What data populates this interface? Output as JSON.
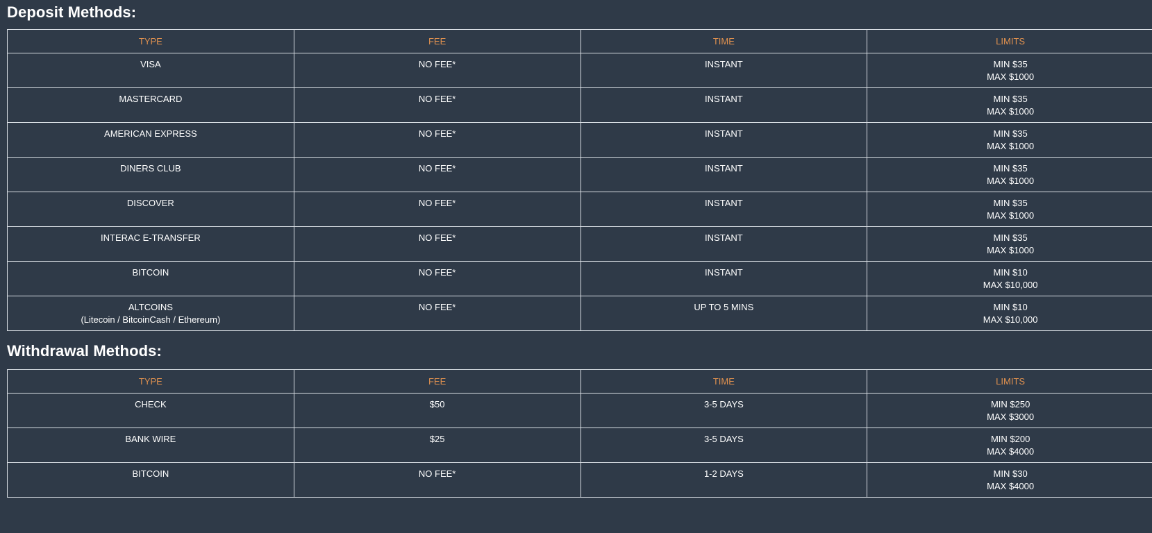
{
  "deposit": {
    "title": "Deposit Methods:",
    "headers": [
      "TYPE",
      "FEE",
      "TIME",
      "LIMITS"
    ],
    "rows": [
      {
        "type": "VISA",
        "type_sub": "",
        "fee": "NO FEE*",
        "time": "INSTANT",
        "min": "MIN $35",
        "max": "MAX $1000"
      },
      {
        "type": "MASTERCARD",
        "type_sub": "",
        "fee": "NO FEE*",
        "time": "INSTANT",
        "min": "MIN $35",
        "max": "MAX $1000"
      },
      {
        "type": "AMERICAN EXPRESS",
        "type_sub": "",
        "fee": "NO FEE*",
        "time": "INSTANT",
        "min": "MIN $35",
        "max": "MAX $1000"
      },
      {
        "type": "DINERS CLUB",
        "type_sub": "",
        "fee": "NO FEE*",
        "time": "INSTANT",
        "min": "MIN $35",
        "max": "MAX $1000"
      },
      {
        "type": "DISCOVER",
        "type_sub": "",
        "fee": "NO FEE*",
        "time": "INSTANT",
        "min": "MIN $35",
        "max": "MAX $1000"
      },
      {
        "type": "INTERAC E-TRANSFER",
        "type_sub": "",
        "fee": "NO FEE*",
        "time": "INSTANT",
        "min": "MIN $35",
        "max": "MAX $1000"
      },
      {
        "type": "BITCOIN",
        "type_sub": "",
        "fee": "NO FEE*",
        "time": "INSTANT",
        "min": "MIN $10",
        "max": "MAX $10,000"
      },
      {
        "type": "ALTCOINS",
        "type_sub": "(Litecoin / BitcoinCash / Ethereum)",
        "fee": "NO FEE*",
        "time": "UP TO 5 MINS",
        "min": "MIN $10",
        "max": "MAX $10,000"
      }
    ]
  },
  "withdrawal": {
    "title": "Withdrawal Methods:",
    "headers": [
      "TYPE",
      "FEE",
      "TIME",
      "LIMITS"
    ],
    "rows": [
      {
        "type": "CHECK",
        "type_sub": "",
        "fee": "$50",
        "time": "3-5 DAYS",
        "min": "MIN $250",
        "max": "MAX $3000"
      },
      {
        "type": "BANK WIRE",
        "type_sub": "",
        "fee": "$25",
        "time": "3-5 DAYS",
        "min": "MIN $200",
        "max": "MAX $4000"
      },
      {
        "type": "BITCOIN",
        "type_sub": "",
        "fee": "NO FEE*",
        "time": "1-2 DAYS",
        "min": "MIN $30",
        "max": "MAX $4000"
      }
    ]
  },
  "colors": {
    "background": "#2f3a48",
    "header_text": "#e0914f",
    "border": "#d9dee4",
    "text": "#ffffff"
  }
}
